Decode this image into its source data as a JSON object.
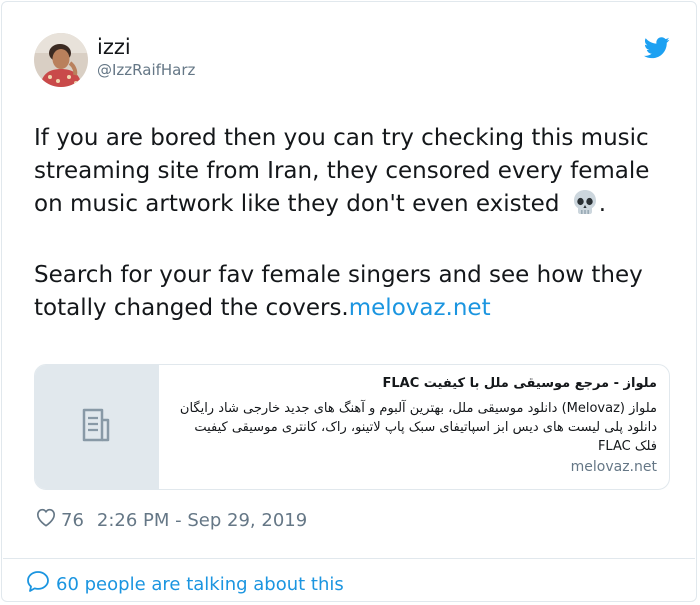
{
  "author": {
    "display_name": "izzi",
    "handle": "@IzzRaifHarz"
  },
  "icons": {
    "brand": "twitter-bird-icon",
    "like": "heart-icon",
    "reply": "speech-bubble-icon",
    "card_placeholder": "document-icon",
    "emoji": "skull-emoji"
  },
  "tweet": {
    "paragraph1": "If you are bored then you can try checking this music streaming site from Iran, they censored every female on music artwork like they don't even existed",
    "paragraph1_end": ".",
    "paragraph2": "Search for your fav female singers and see how they totally changed the covers.",
    "link_text": "melovaz.net"
  },
  "link_card": {
    "title": "ملواز - مرجع موسیقی ملل با کیفیت FLAC",
    "description": "ملواز (Melovaz) دانلود موسیقی ملل، بهترین آلبوم و آهنگ های جدید خارجی شاد رایگان دانلود پلی لیست های دیس ابز اسپاتیفای سبک پاپ لاتینو، راک، کانتری موسیقی کیفیت فلک FLAC",
    "domain": "melovaz.net"
  },
  "meta": {
    "like_count": "76",
    "timestamp": "2:26 PM - Sep 29, 2019"
  },
  "footer": {
    "talking_text": "60 people are talking about this"
  },
  "colors": {
    "brand_blue": "#1da1f2",
    "link_blue": "#1b95e0",
    "secondary_text": "#657786",
    "border": "#e1e8ed"
  }
}
